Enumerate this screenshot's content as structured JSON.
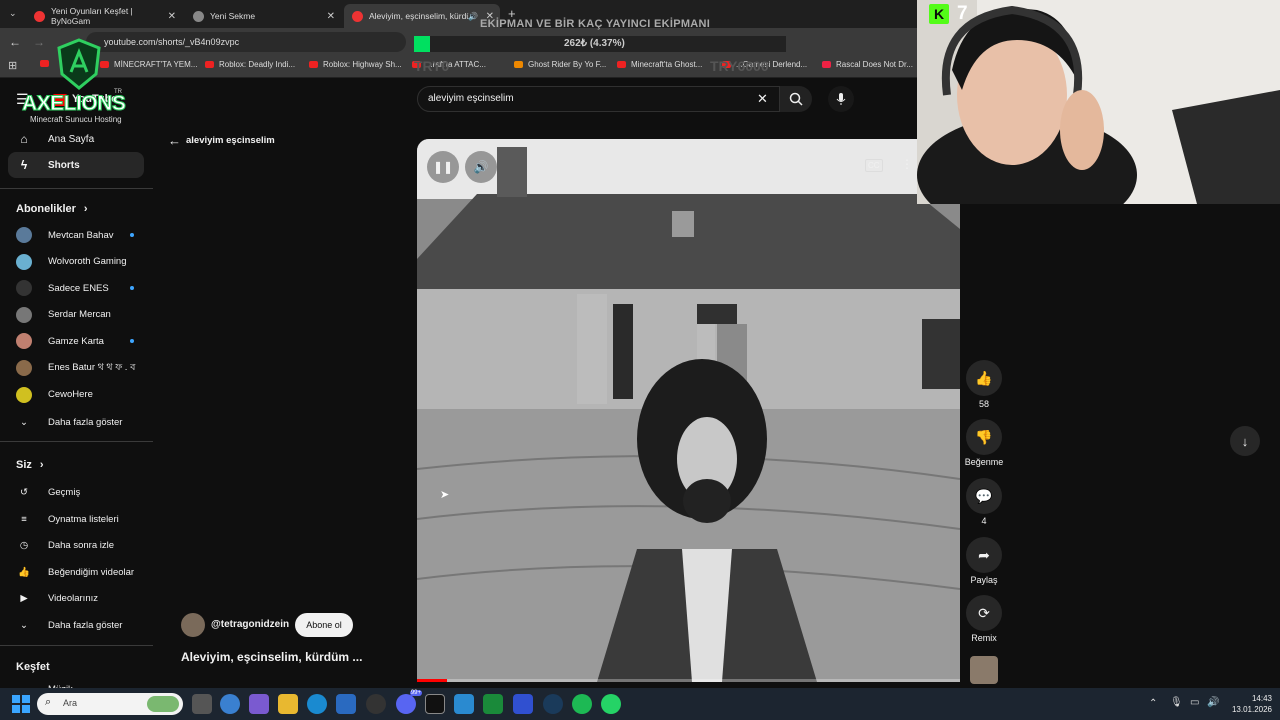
{
  "browser": {
    "tabs": [
      {
        "title": "Yeni Oyunları Keşfet | ByNoGam",
        "favicon_color": "#e33"
      },
      {
        "title": "Yeni Sekme",
        "favicon_color": "#888"
      },
      {
        "title": "Aleviyim, eşcinselim, kürdü",
        "favicon_color": "#e33"
      }
    ],
    "url": "youtube.com/shorts/_vB4n09zvpc",
    "bookmarks": [
      "MİNECRAFT'TA YEM...",
      "Roblox: Deadly Indi...",
      "Roblox: Highway Sh...",
      "...raft'ta ATTAC...",
      "Ghost Rider By Yo F...",
      "Minecraft'ta Ghost...",
      "...Gamesi Derlend...",
      "Rascal Does Not Dr..."
    ]
  },
  "overlay": {
    "goal_title": "EKİPMAN VE BİR KAÇ YAYINCI EKİPMANI",
    "goal_progress_text": "262₺ (4.37%)",
    "goal_progress": 0.0437,
    "goal_start": "TRY0",
    "goal_end": "TRY6000",
    "brand_name": "AXELIONS",
    "brand_tagline": "Minecraft Sunucu Hosting",
    "tr_badge": "TR",
    "kick_count": "7"
  },
  "youtube": {
    "logo_text": "YouTube",
    "search_value": "aleviyim eşcinselim",
    "back_label": "aleviyim eşcinselim",
    "nav_home": "Ana Sayfa",
    "nav_shorts": "Shorts",
    "subs_header": "Abonelikler",
    "subscriptions": [
      {
        "name": "Mevtcan Bahav",
        "color": "#5a7a9a",
        "dot": true
      },
      {
        "name": "Wolvoroth Gaming",
        "color": "#6ab0d0",
        "dot": false
      },
      {
        "name": "Sadece ENES",
        "color": "#333333",
        "dot": true
      },
      {
        "name": "Serdar Mercan",
        "color": "#777777",
        "dot": false
      },
      {
        "name": "Gamze Karta",
        "color": "#c08070",
        "dot": true
      },
      {
        "name": "Enes Batur থ থ ফ . ব",
        "color": "#8a6a4a",
        "dot": false
      },
      {
        "name": "CewoHere",
        "color": "#d0c020",
        "dot": false
      }
    ],
    "show_more": "Daha fazla göster",
    "you_header": "Siz",
    "you_items": [
      "Geçmiş",
      "Oynatma listeleri",
      "Daha sonra izle",
      "Beğendiğim videolar",
      "Videolarınız",
      "Daha fazla göster"
    ],
    "explore_header": "Keşfet",
    "explore_partial": "Müzik",
    "channel_handle": "@tetragonidzein",
    "subscribe_label": "Abone ol",
    "video_title": "Aleviyim, eşcinselim, kürdüm ...",
    "actions": {
      "like_count": "58",
      "dislike_label": "Beğenme",
      "comment_count": "4",
      "share_label": "Paylaş",
      "remix_label": "Remix"
    },
    "cc_label": "CC"
  },
  "taskbar": {
    "search_placeholder": "Ara",
    "time": "14:43",
    "date": "13.01.2026",
    "discord_badge": "99+"
  },
  "colors": {
    "accent_red": "#ff0000",
    "subscribe_bg": "#f1f1f1",
    "link_blue": "#3ea6ff",
    "goal_green": "#00e060"
  }
}
